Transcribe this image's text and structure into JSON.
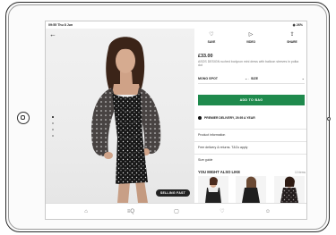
{
  "status_bar": {
    "time": "09:55  Thu 8 Jun",
    "battery": "◉ 26%"
  },
  "gallery": {
    "back_icon": "←",
    "dots": [
      true,
      false,
      false,
      false
    ],
    "badge": "SELLING FAST"
  },
  "actions": [
    {
      "name": "save",
      "icon": "♡",
      "label": "SAVE"
    },
    {
      "name": "video",
      "icon": "▷",
      "label": "VIDEO"
    },
    {
      "name": "share",
      "icon": "⇪",
      "label": "SHARE"
    }
  ],
  "product": {
    "price": "£33.00",
    "description": "ASOS DESIGN ruched bodycon mini dress with balloon sleeves in polka dot",
    "colour": "MONO SPOT",
    "size_label": "SIZE",
    "add_to_bag": "ADD TO BAG",
    "delivery": "PREMIER DELIVERY, 29.95 A YEAR"
  },
  "info_rows": [
    "Product information",
    "Free delivery & returns. T&Cs apply",
    "Size guide"
  ],
  "recommendations": {
    "title": "YOU MIGHT ALSO LIKE",
    "count": "10 items"
  },
  "tabbar": [
    {
      "name": "home",
      "icon": "⌂"
    },
    {
      "name": "search",
      "icon": "≡Q"
    },
    {
      "name": "bag",
      "icon": "▢"
    },
    {
      "name": "saved",
      "icon": "♡"
    },
    {
      "name": "account",
      "icon": "☺"
    }
  ]
}
